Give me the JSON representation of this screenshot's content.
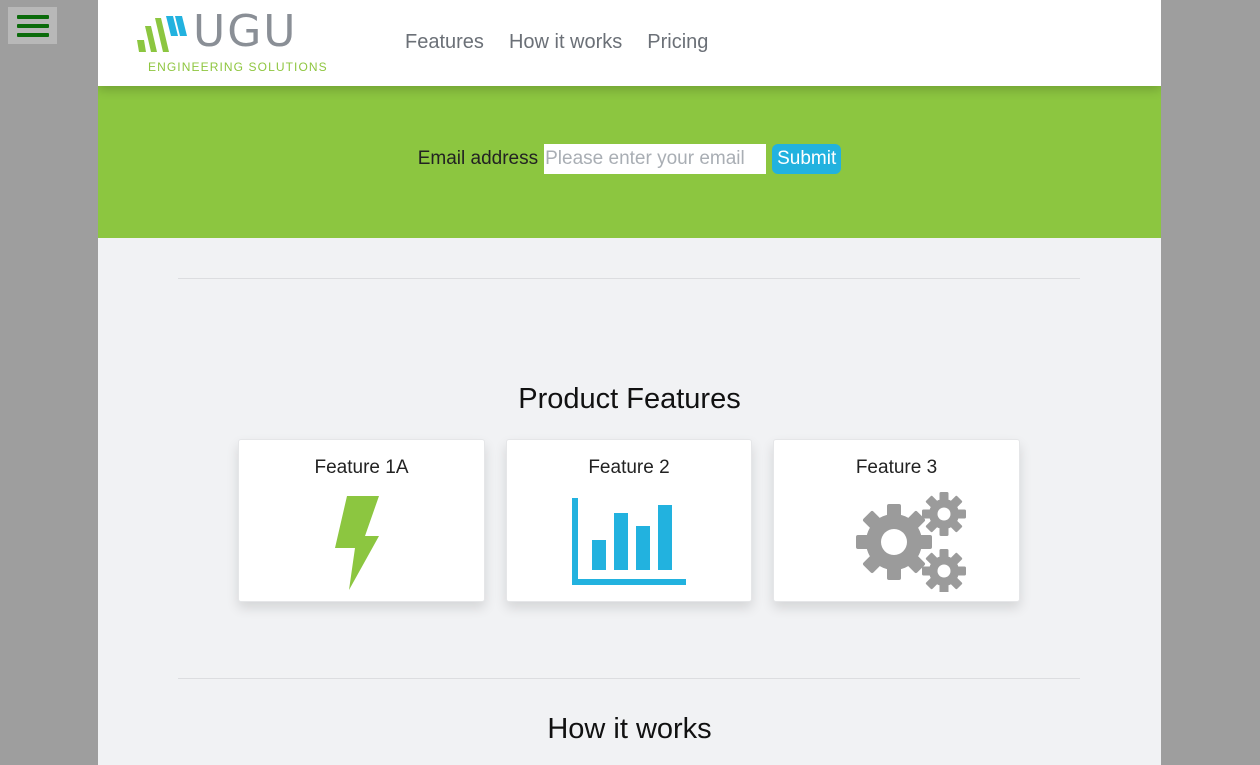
{
  "menu": {
    "icon": "hamburger-menu-icon"
  },
  "brand": {
    "name": "UGU",
    "tagline": "ENGINEERING SOLUTIONS",
    "colors": {
      "green": "#8cc640",
      "blue": "#22b2df",
      "gray": "#8a8f96"
    }
  },
  "nav": {
    "items": [
      "Features",
      "How it works",
      "Pricing"
    ]
  },
  "signup": {
    "label": "Email address",
    "placeholder": "Please enter your email",
    "value": "",
    "submit_label": "Submit"
  },
  "features": {
    "title": "Product Features",
    "cards": [
      {
        "title": "Feature 1A",
        "icon": "lightning-bolt-icon",
        "color": "#8cc640"
      },
      {
        "title": "Feature 2",
        "icon": "bar-chart-icon",
        "color": "#22b2df"
      },
      {
        "title": "Feature 3",
        "icon": "gears-icon",
        "color": "#9b9b9b"
      }
    ]
  },
  "how_it_works": {
    "title": "How it works"
  }
}
